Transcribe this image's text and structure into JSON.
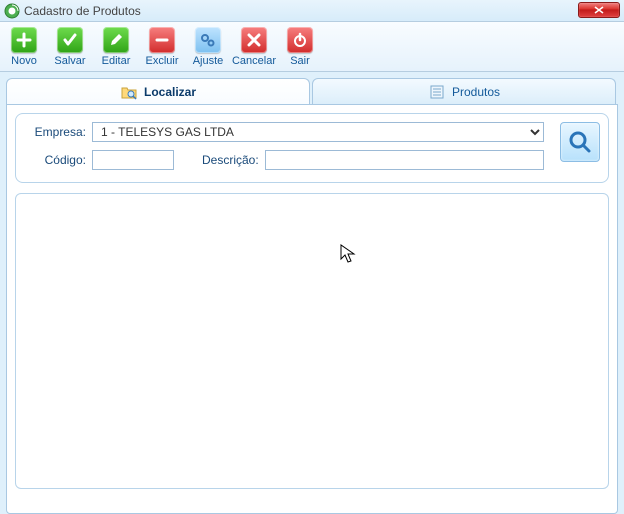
{
  "window": {
    "title": "Cadastro de Produtos"
  },
  "toolbar": {
    "novo": "Novo",
    "salvar": "Salvar",
    "editar": "Editar",
    "excluir": "Excluir",
    "ajuste": "Ajuste",
    "cancelar": "Cancelar",
    "sair": "Sair"
  },
  "tabs": {
    "localizar": "Localizar",
    "produtos": "Produtos"
  },
  "search": {
    "empresa_label": "Empresa:",
    "empresa_value": "1 - TELESYS GAS LTDA",
    "codigo_label": "Código:",
    "codigo_value": "",
    "descricao_label": "Descrição:",
    "descricao_value": ""
  }
}
